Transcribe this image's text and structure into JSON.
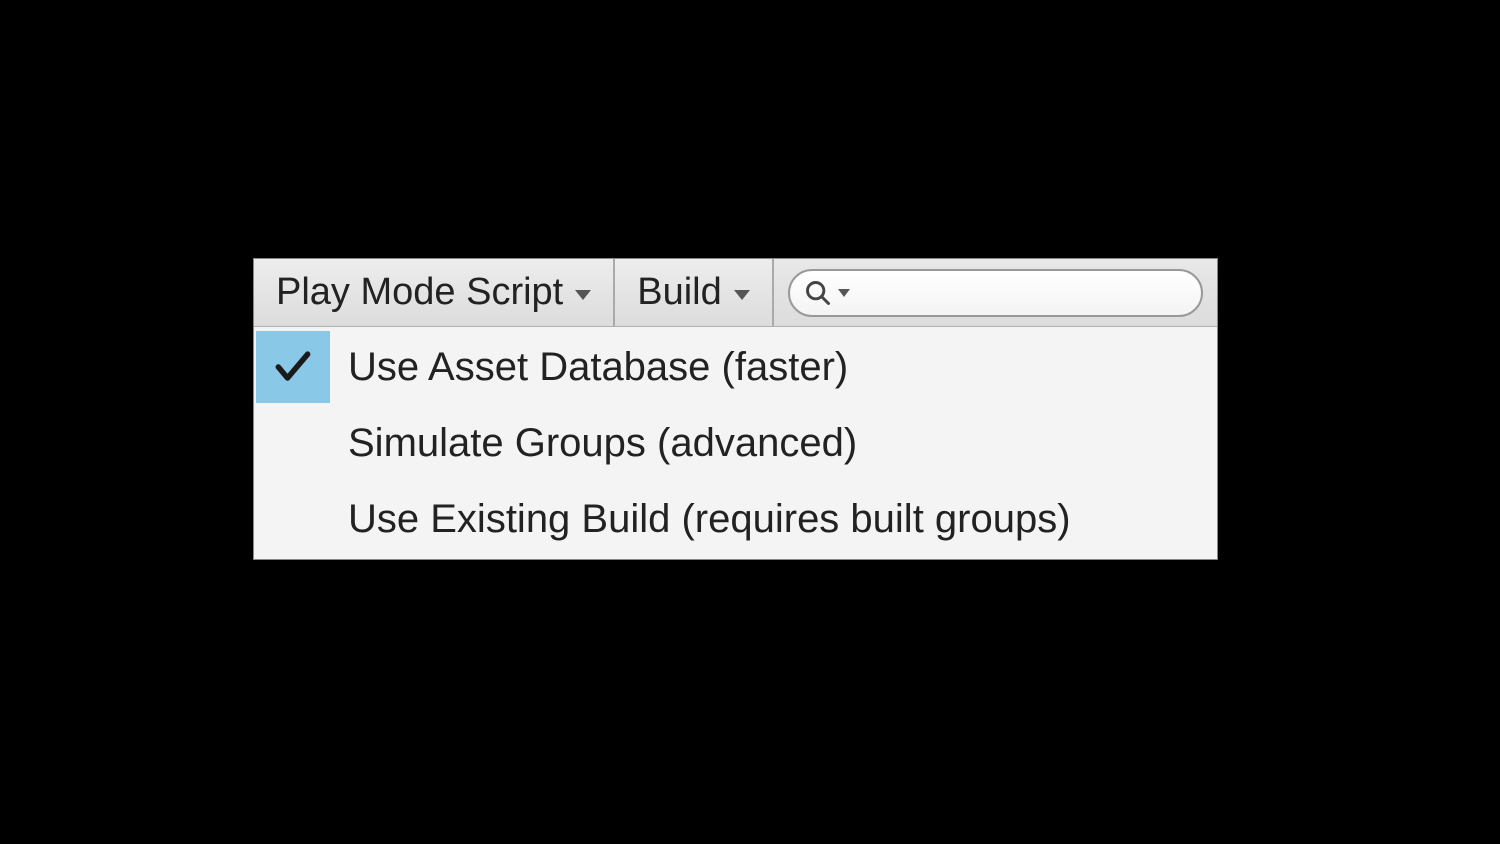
{
  "toolbar": {
    "play_mode_label": "Play Mode Script",
    "build_label": "Build",
    "search_placeholder": ""
  },
  "menu": {
    "items": [
      {
        "label": "Use Asset Database (faster)",
        "selected": true
      },
      {
        "label": "Simulate Groups (advanced)",
        "selected": false
      },
      {
        "label": "Use Existing Build (requires built groups)",
        "selected": false
      }
    ]
  }
}
